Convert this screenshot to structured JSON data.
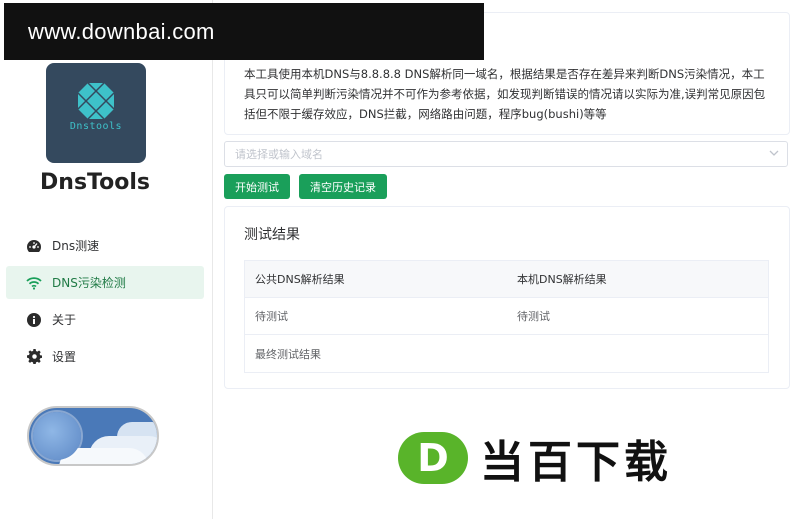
{
  "watermark": {
    "top_text": "www.downbai.com",
    "bottom_badge": "D",
    "bottom_text": "当百下载"
  },
  "app": {
    "logo_text": "Dnstools",
    "title": "DnsTools"
  },
  "sidebar": {
    "items": [
      {
        "label": "Dns测速",
        "icon": "speedometer-icon",
        "active": false
      },
      {
        "label": "DNS污染检测",
        "icon": "wifi-icon",
        "active": true
      },
      {
        "label": "关于",
        "icon": "info-icon",
        "active": false
      },
      {
        "label": "设置",
        "icon": "gear-icon",
        "active": false
      }
    ],
    "theme_toggle": {
      "state": "light"
    }
  },
  "main": {
    "description": "本工具使用本机DNS与8.8.8.8 DNS解析同一域名，根据结果是否存在差异来判断DNS污染情况，本工具只可以简单判断污染情况并不可作为参考依据，如发现判断错误的情况请以实际为准,误判常见原因包括但不限于缓存效应，DNS拦截，网络路由问题，程序bug(bushi)等等",
    "domain_input": {
      "placeholder": "请选择或输入域名",
      "value": ""
    },
    "buttons": {
      "start": "开始测试",
      "clear": "清空历史记录"
    },
    "results": {
      "title": "测试结果",
      "headers": [
        "公共DNS解析结果",
        "本机DNS解析结果"
      ],
      "rows": [
        [
          "待测试",
          "待测试"
        ]
      ],
      "final_label": "最终测试结果"
    }
  },
  "colors": {
    "primary": "#1a9f5a",
    "active_bg": "#e8f5ee",
    "logo_bg": "#34495e",
    "logo_accent": "#3ec1c9"
  }
}
